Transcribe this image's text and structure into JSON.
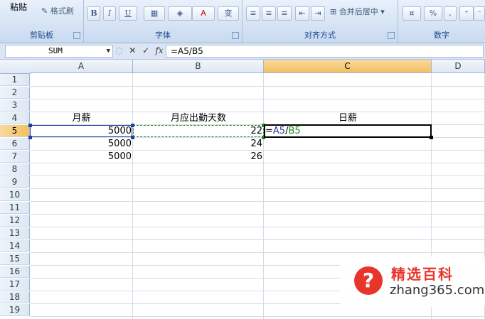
{
  "ribbon": {
    "clipboard": {
      "paste_label": "粘贴",
      "format_painter_label": "格式刷",
      "group_label": "剪贴板"
    },
    "font": {
      "bold": "B",
      "italic": "I",
      "underline": "U",
      "font_color_glyph": "A",
      "phonetic_glyph": "变",
      "group_label": "字体"
    },
    "alignment": {
      "merge_label": "合并后居中",
      "group_label": "对齐方式"
    },
    "number": {
      "percent_glyph": "%",
      "comma_glyph": ",",
      "group_label": "数字"
    }
  },
  "formula_bar": {
    "name_box": "SUM",
    "cancel_glyph": "✕",
    "enter_glyph": "✓",
    "fx_glyph": "fx",
    "formula": "=A5/B5"
  },
  "columns": [
    "A",
    "B",
    "C",
    "D"
  ],
  "selected_column": "C",
  "rows": [
    "1",
    "2",
    "3",
    "4",
    "5",
    "6",
    "7",
    "8",
    "9",
    "10",
    "11",
    "12",
    "13",
    "14",
    "15",
    "16",
    "17",
    "18",
    "19"
  ],
  "selected_row": "5",
  "cells": {
    "A4": "月薪",
    "B4": "月应出勤天数",
    "C4": "日薪",
    "A5": "5000",
    "B5": "22",
    "A6": "5000",
    "B6": "24",
    "A7": "5000",
    "B7": "26"
  },
  "edit": {
    "eq": "=",
    "ref_a": "A5",
    "slash": "/",
    "ref_b": "B5"
  },
  "colors": {
    "ref_a": "#1f3ea8",
    "ref_b": "#1d8a1d",
    "selected_header": "#f1c15f"
  },
  "watermark": {
    "mark": "?",
    "title": "精选百科",
    "url": "zhang365.com"
  }
}
